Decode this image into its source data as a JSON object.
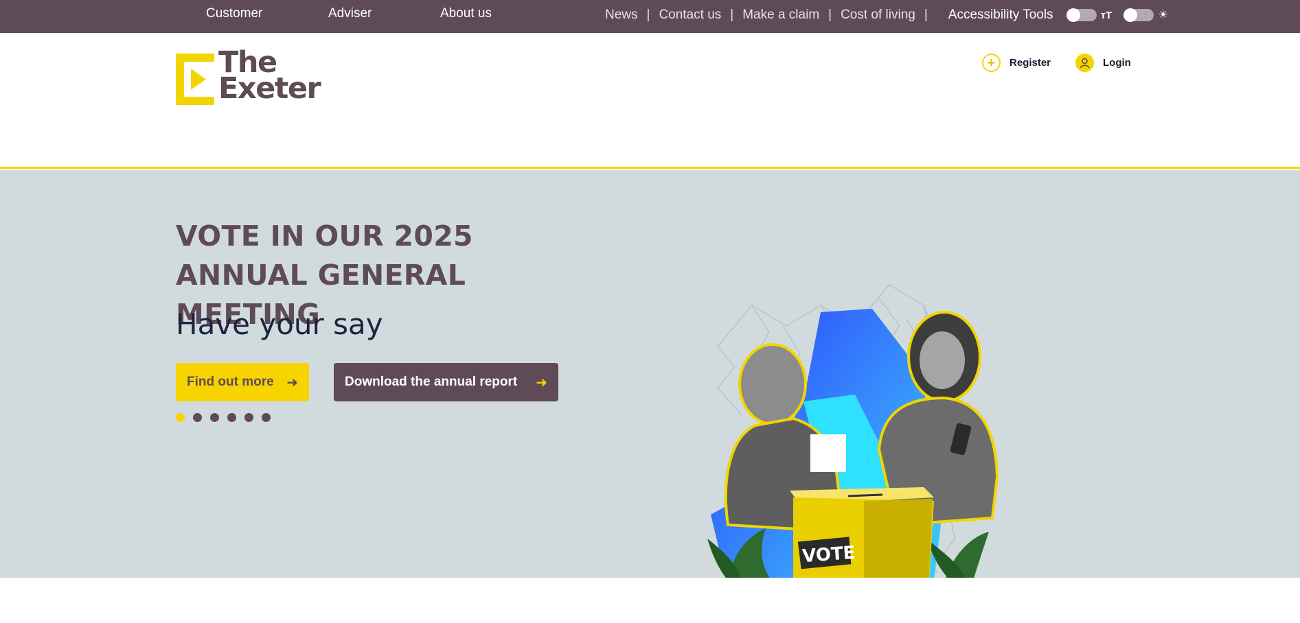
{
  "top_nav": {
    "primary": [
      "Customer",
      "Adviser",
      "About us"
    ],
    "utility": [
      "News",
      "Contact us",
      "Make a claim",
      "Cost of living"
    ],
    "accessibility_label": "Accessibility Tools",
    "text_size_toggle": {
      "icon": "text-size-icon",
      "glyph": "тT",
      "on": false
    },
    "contrast_toggle": {
      "icon": "sun-icon",
      "on": false
    },
    "background": "#5e4b56"
  },
  "header": {
    "logo_text": [
      "The",
      "Exeter"
    ],
    "register_label": "Register",
    "login_label": "Login",
    "accent": "#f2d500"
  },
  "hero": {
    "title": "VOTE IN OUR 2025 ANNUAL GENERAL MEETING",
    "subtitle": "Have your say",
    "primary_button": "Find out more",
    "secondary_button": "Download the annual report",
    "carousel_slide_count": 6,
    "carousel_active_index": 0,
    "illustration_box_label": "VOTE",
    "background": "#d1dbdd"
  }
}
